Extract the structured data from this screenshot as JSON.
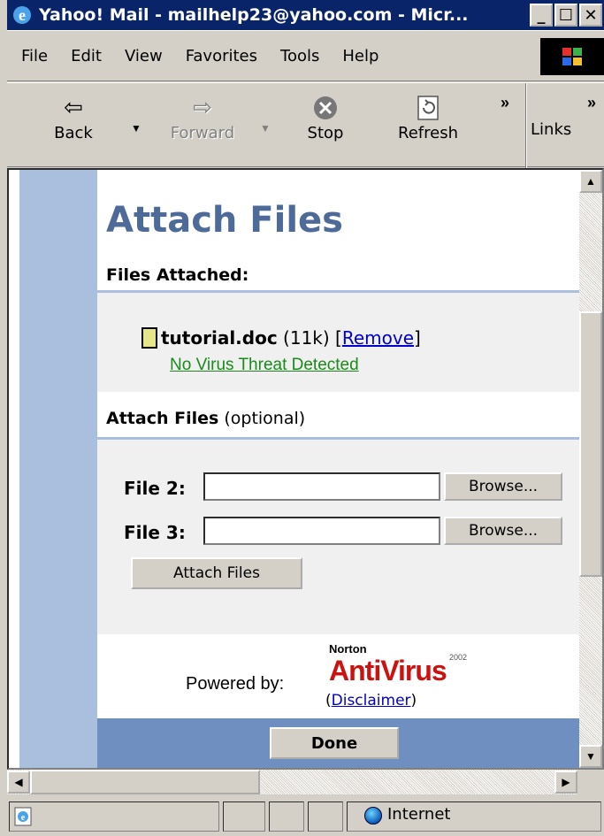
{
  "window": {
    "title": "Yahoo! Mail - mailhelp23@yahoo.com - Micr...",
    "min_label": "_",
    "max_label": "☐",
    "close_label": "✕"
  },
  "menu": {
    "items": [
      "File",
      "Edit",
      "View",
      "Favorites",
      "Tools",
      "Help"
    ]
  },
  "toolbar": {
    "back": "Back",
    "forward": "Forward",
    "stop": "Stop",
    "refresh": "Refresh",
    "links": "Links",
    "chevron": "»"
  },
  "page": {
    "heading": "Attach Files",
    "files_attached_label": "Files Attached:",
    "attached_file": {
      "name": "tutorial.doc",
      "size": "(11k)",
      "remove_open": "[",
      "remove_label": "Remove",
      "remove_close": "]",
      "virus_status": "No Virus Threat Detected"
    },
    "attach_section": {
      "label_bold": "Attach Files",
      "label_rest": "(optional)"
    },
    "file2_label": "File 2:",
    "file3_label": "File 3:",
    "browse_label": "Browse...",
    "attach_button": "Attach Files",
    "powered_by": "Powered by:",
    "norton": "Norton",
    "antivirus": "AntiVirus",
    "antivirus_year": "2002",
    "disclaimer_open": "(",
    "disclaimer_label": "Disclaimer",
    "disclaimer_close": ")",
    "done_button": "Done"
  },
  "status": {
    "zone": "Internet"
  }
}
